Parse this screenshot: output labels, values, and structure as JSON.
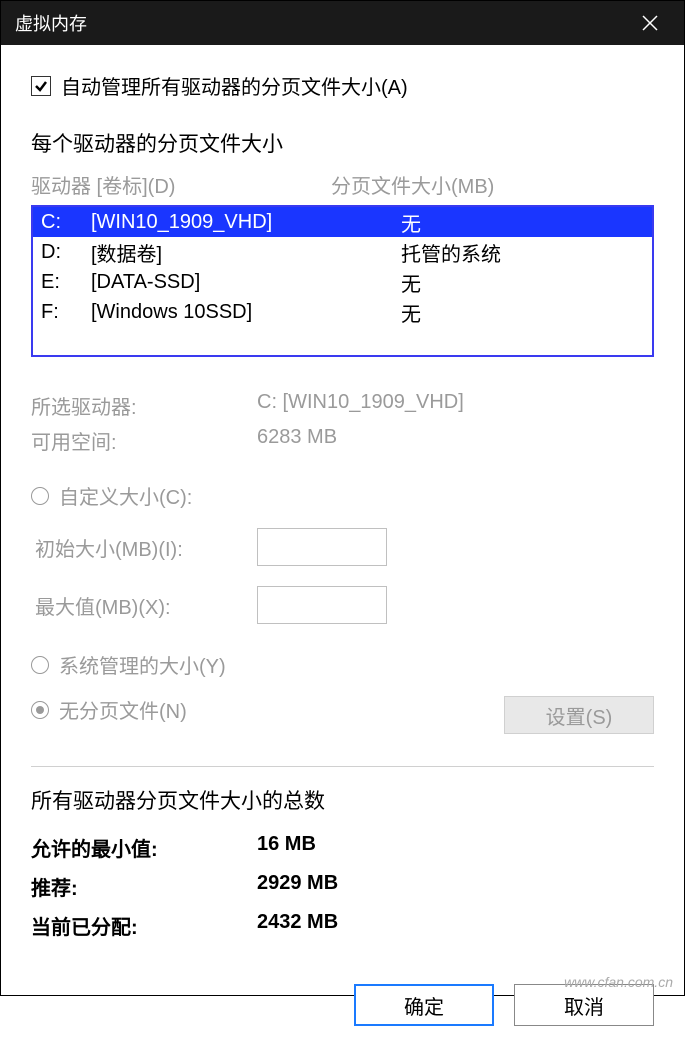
{
  "title": "虚拟内存",
  "auto_manage_label": "自动管理所有驱动器的分页文件大小(A)",
  "auto_manage_checked": true,
  "section_each_drive": "每个驱动器的分页文件大小",
  "headers": {
    "drive": "驱动器 [卷标](D)",
    "size": "分页文件大小(MB)"
  },
  "drives": [
    {
      "letter": "C:",
      "label": "[WIN10_1909_VHD]",
      "size": "无",
      "selected": true
    },
    {
      "letter": "D:",
      "label": "[数据卷]",
      "size": "托管的系统",
      "selected": false
    },
    {
      "letter": "E:",
      "label": "[DATA-SSD]",
      "size": "无",
      "selected": false
    },
    {
      "letter": "F:",
      "label": "[Windows 10SSD]",
      "size": "无",
      "selected": false
    }
  ],
  "selected_drive": {
    "label_key": "所选驱动器:",
    "label_val": "C: [WIN10_1909_VHD]",
    "free_key": "可用空间:",
    "free_val": "6283 MB"
  },
  "radios": {
    "custom": "自定义大小(C):",
    "initial": "初始大小(MB)(I):",
    "max": "最大值(MB)(X):",
    "system": "系统管理的大小(Y)",
    "none": "无分页文件(N)"
  },
  "set_button": "设置(S)",
  "totals_title": "所有驱动器分页文件大小的总数",
  "totals": {
    "min_label": "允许的最小值:",
    "min_val": "16 MB",
    "rec_label": "推荐:",
    "rec_val": "2929 MB",
    "cur_label": "当前已分配:",
    "cur_val": "2432 MB"
  },
  "buttons": {
    "ok": "确定",
    "cancel": "取消"
  },
  "watermark": "www.cfan.com.cn"
}
